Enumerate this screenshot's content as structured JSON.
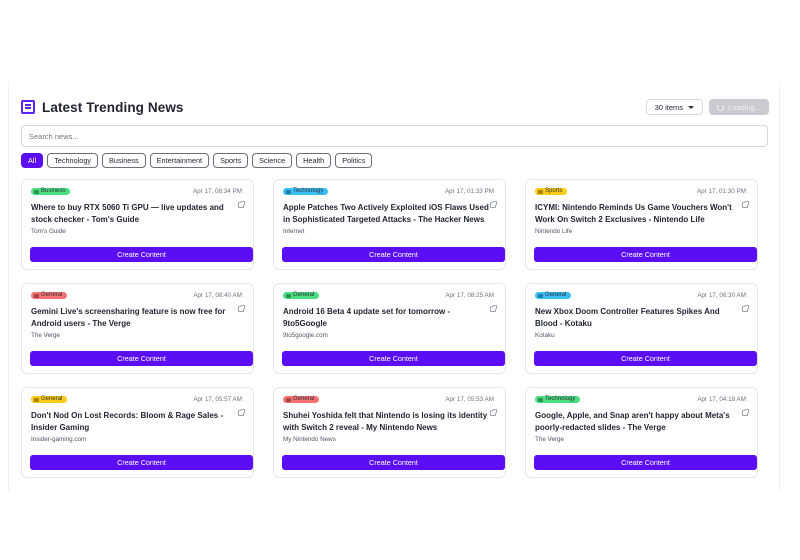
{
  "header": {
    "title": "Latest Trending News",
    "count_label": "30 items",
    "loading_label": "Loading..."
  },
  "search": {
    "placeholder": "Search news..."
  },
  "filters": [
    "All",
    "Technology",
    "Business",
    "Entertainment",
    "Sports",
    "Science",
    "Health",
    "Politics"
  ],
  "active_filter": "All",
  "colors": {
    "accent": "#5b0ef6",
    "Business": "#4ade80",
    "Technology": "#38bdf8",
    "Sports": "#facc15",
    "General": "#f87171"
  },
  "cards": [
    {
      "category": "Business",
      "badge_color": "#4ade80",
      "date": "Apr 17, 08:34 PM",
      "title": "Where to buy RTX 5060 Ti GPU — live updates and stock checker - Tom's Guide",
      "source": "Tom's Guide",
      "button": "Create Content"
    },
    {
      "category": "Technology",
      "badge_color": "#38bdf8",
      "date": "Apr 17, 01:33 PM",
      "title": "Apple Patches Two Actively Exploited iOS Flaws Used in Sophisticated Targeted Attacks - The Hacker News",
      "source": "Internet",
      "button": "Create Content"
    },
    {
      "category": "Sports",
      "badge_color": "#facc15",
      "date": "Apr 17, 01:30 PM",
      "title": "ICYMI: Nintendo Reminds Us Game Vouchers Won't Work On Switch 2 Exclusives - Nintendo Life",
      "source": "Nintendo Life",
      "button": "Create Content"
    },
    {
      "category": "General",
      "badge_color": "#f87171",
      "date": "Apr 17, 08:40 AM",
      "title": "Gemini Live's screensharing feature is now free for Android users - The Verge",
      "source": "The Verge",
      "button": "Create Content"
    },
    {
      "category": "General",
      "badge_color": "#4ade80",
      "date": "Apr 17, 08:25 AM",
      "title": "Android 16 Beta 4 update set for tomorrow - 9to5Google",
      "source": "9to5google.com",
      "button": "Create Content"
    },
    {
      "category": "General",
      "badge_color": "#38bdf8",
      "date": "Apr 17, 06:30 AM",
      "title": "New Xbox Doom Controller Features Spikes And Blood - Kotaku",
      "source": "Kotaku",
      "button": "Create Content"
    },
    {
      "category": "General",
      "badge_color": "#facc15",
      "date": "Apr 17, 05:57 AM",
      "title": "Don't Nod On Lost Records: Bloom & Rage Sales - Insider Gaming",
      "source": "Insider-gaming.com",
      "button": "Create Content"
    },
    {
      "category": "General",
      "badge_color": "#f87171",
      "date": "Apr 17, 05:53 AM",
      "title": "Shuhei Yoshida felt that Nintendo is losing its identity with Switch 2 reveal - My Nintendo News",
      "source": "My Nintendo News",
      "button": "Create Content"
    },
    {
      "category": "Technology",
      "badge_color": "#4ade80",
      "date": "Apr 17, 04:18 AM",
      "title": "Google, Apple, and Snap aren't happy about Meta's poorly-redacted slides - The Verge",
      "source": "The Verge",
      "button": "Create Content"
    }
  ]
}
